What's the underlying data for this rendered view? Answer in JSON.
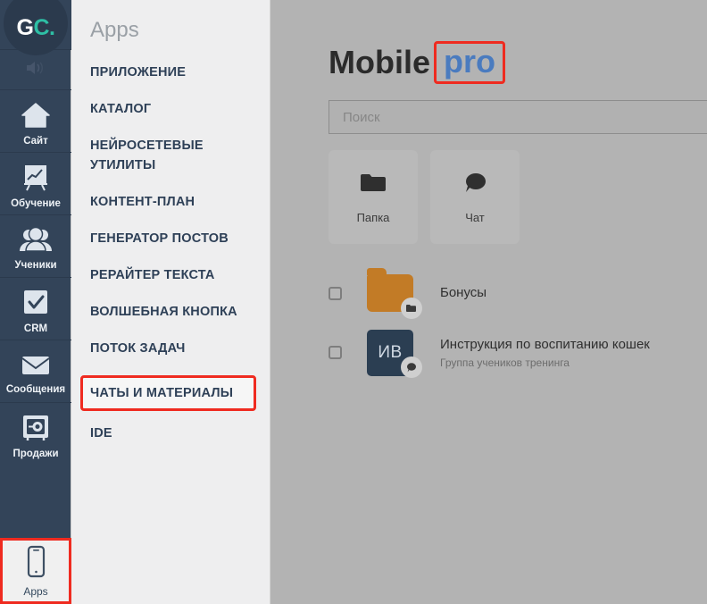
{
  "rail": {
    "logo": {
      "name": "gc-logo",
      "part1": "G",
      "part2": "C.",
      "color1": "#ffffff",
      "color2": "#2ebfa5"
    },
    "speaker": {
      "icon": "speaker-muted-icon"
    },
    "items": [
      {
        "label": "Сайт",
        "icon": "home-icon",
        "name": "sidebar-item-site"
      },
      {
        "label": "Обучение",
        "icon": "chart-board-icon",
        "name": "sidebar-item-training"
      },
      {
        "label": "Ученики",
        "icon": "users-icon",
        "name": "sidebar-item-students"
      },
      {
        "label": "CRM",
        "icon": "checkbox-square-icon",
        "name": "sidebar-item-crm"
      },
      {
        "label": "Сообщения",
        "icon": "envelope-icon",
        "name": "sidebar-item-messages"
      },
      {
        "label": "Продажи",
        "icon": "safe-vault-icon",
        "name": "sidebar-item-sales"
      }
    ],
    "apps": {
      "label": "Apps",
      "icon": "mobile-phone-icon",
      "highlight_color": "#ef2b20",
      "selected": true
    }
  },
  "menu": {
    "title": "Apps",
    "items": [
      {
        "label": "ПРИЛОЖЕНИЕ",
        "highlighted": false
      },
      {
        "label": "КАТАЛОГ",
        "highlighted": false
      },
      {
        "label": "НЕЙРОСЕТЕВЫЕ УТИЛИТЫ",
        "highlighted": false
      },
      {
        "label": "КОНТЕНТ-ПЛАН",
        "highlighted": false
      },
      {
        "label": "ГЕНЕРАТОР ПОСТОВ",
        "highlighted": false
      },
      {
        "label": "РЕРАЙТЕР ТЕКСТА",
        "highlighted": false
      },
      {
        "label": "ВОЛШЕБНАЯ КНОПКА",
        "highlighted": false
      },
      {
        "label": "ПОТОК ЗАДАЧ",
        "highlighted": false
      },
      {
        "label": "ЧАТЫ И МАТЕРИАЛЫ",
        "highlighted": true
      },
      {
        "label": "IDE",
        "highlighted": false
      }
    ],
    "highlight_color": "#ef2b20"
  },
  "main": {
    "title_part1": "Mobile",
    "title_part2": "pro",
    "title_part2_color": "#4a7bbf",
    "title_highlight_color": "#ef2b20",
    "search": {
      "placeholder": "Поиск",
      "value": ""
    },
    "cards": [
      {
        "label": "Папка",
        "icon": "folder-icon",
        "name": "create-folder-card"
      },
      {
        "label": "Чат",
        "icon": "chat-bubble-icon",
        "name": "create-chat-card"
      }
    ],
    "list": [
      {
        "type": "folder",
        "title": "Бонусы",
        "subtitle": "",
        "checked": false,
        "icon": "folder-icon",
        "badge_icon": "folder-badge-icon",
        "color": "#c27b26"
      },
      {
        "type": "chat",
        "title": "Инструкция по воспитанию кошек",
        "subtitle": "Группа учеников тренинга",
        "checked": false,
        "initials": "ИВ",
        "badge_icon": "chat-badge-icon",
        "color": "#2b3e52"
      }
    ]
  }
}
